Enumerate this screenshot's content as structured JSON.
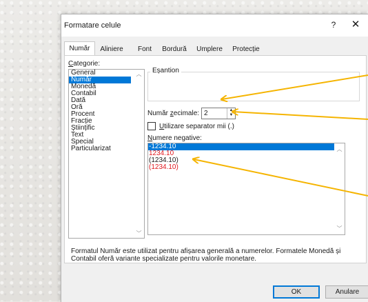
{
  "dialog": {
    "title": "Formatare celule",
    "help": "?",
    "close": "✕"
  },
  "tabs": [
    {
      "label": "Număr"
    },
    {
      "label": "Aliniere"
    },
    {
      "label": "Font"
    },
    {
      "label": "Bordură"
    },
    {
      "label": "Umplere"
    },
    {
      "label": "Protecție"
    }
  ],
  "category": {
    "label": "Categorie:",
    "items": [
      "General",
      "Număr",
      "Monedă",
      "Contabil",
      "Dată",
      "Oră",
      "Procent",
      "Fracție",
      "Științific",
      "Text",
      "Special",
      "Particularizat"
    ],
    "selected": "Număr"
  },
  "sample": {
    "label": "Eșantion"
  },
  "decimals": {
    "label": "Număr zecimale:",
    "value": "2"
  },
  "separator": {
    "label": "Utilizare separator mii (.)",
    "checked": false
  },
  "negative": {
    "label": "Numere negative:",
    "items": [
      {
        "text": "-1234.10",
        "color": "#ffffff",
        "selected": true
      },
      {
        "text": "1234.10",
        "color": "#e0161c"
      },
      {
        "text": "(1234.10)",
        "color": "#1a1a1a"
      },
      {
        "text": "(1234.10)",
        "color": "#e0161c"
      }
    ]
  },
  "description": "Formatul Număr este utilizat pentru afișarea generală a numerelor. Formatele Monedă și Contabil oferă variante specializate pentru valorile monetare.",
  "buttons": {
    "ok": "OK",
    "cancel": "Anulare"
  },
  "annotation_color": "#f5b400"
}
